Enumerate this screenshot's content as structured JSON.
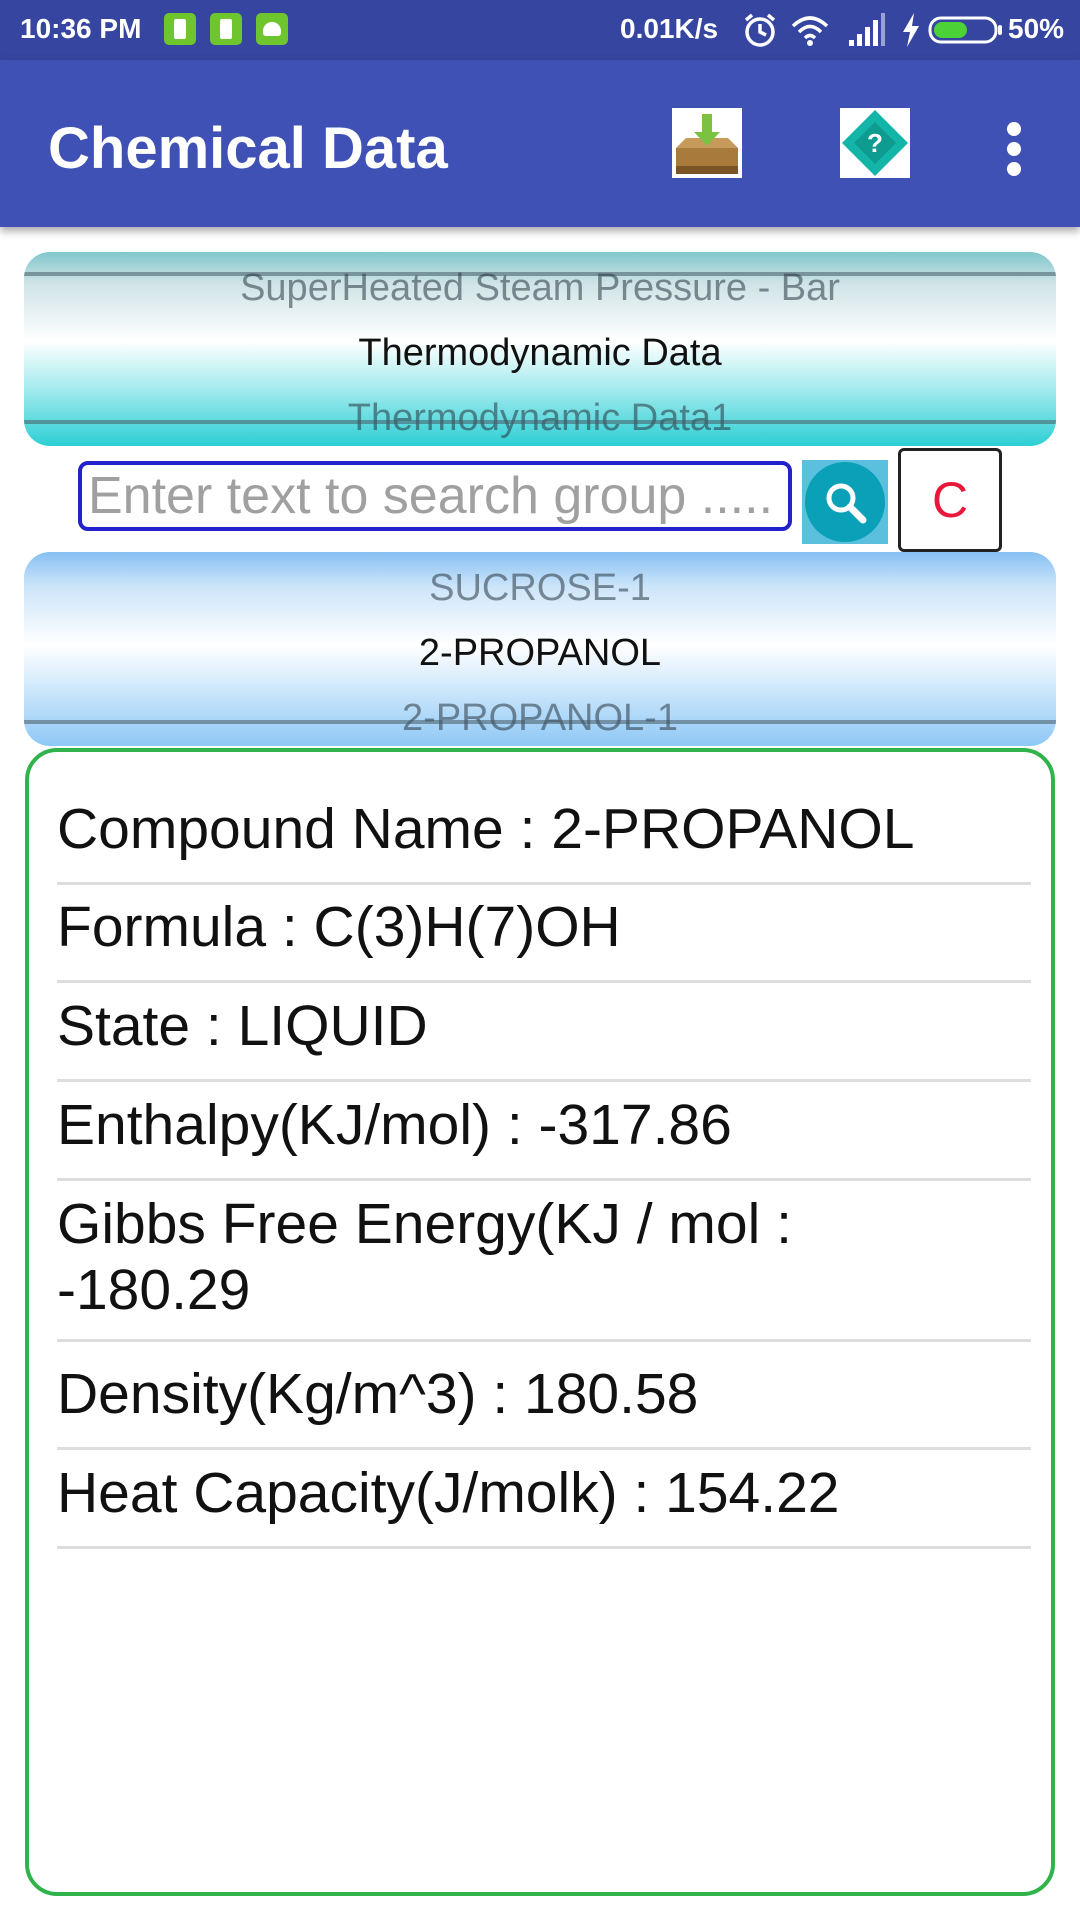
{
  "status_bar": {
    "time": "10:36 PM",
    "net_speed": "0.01K/s",
    "battery_percent": "50%",
    "icons": [
      "battery-notification-icon",
      "battery-notification-icon",
      "android-notification-icon",
      "alarm-icon",
      "wifi-icon",
      "signal-icon",
      "charging-icon",
      "battery-icon"
    ],
    "battery_level": 0.5,
    "battery_color": "#4cd137"
  },
  "app_bar": {
    "title": "Chemical Data",
    "color": "#3f51b5",
    "icons": [
      "download-icon",
      "help-icon",
      "overflow-menu-icon"
    ]
  },
  "category_picker": {
    "items": [
      "SuperHeated Steam Pressure - Bar",
      "Thermodynamic Data",
      "Thermodynamic Data1"
    ],
    "selected": "Thermodynamic Data"
  },
  "search": {
    "placeholder": "Enter text to search group .....",
    "value": "",
    "clear_label": "C",
    "clear_color": "#e8173c",
    "border_color": "#2222cc"
  },
  "compound_picker": {
    "items": [
      "SUCROSE-1",
      "2-PROPANOL",
      "2-PROPANOL-1"
    ],
    "selected": "2-PROPANOL"
  },
  "details": {
    "border_color": "#2fb34a",
    "rows": [
      "Compound Name : 2-PROPANOL",
      "Formula : C(3)H(7)OH",
      "State : LIQUID",
      "Enthalpy(KJ/mol) : -317.86",
      "Gibbs Free Energy(KJ / mol :",
      "-180.29",
      "Density(Kg/m^3) : 180.58",
      "Heat Capacity(J/molk) : 154.22"
    ]
  }
}
